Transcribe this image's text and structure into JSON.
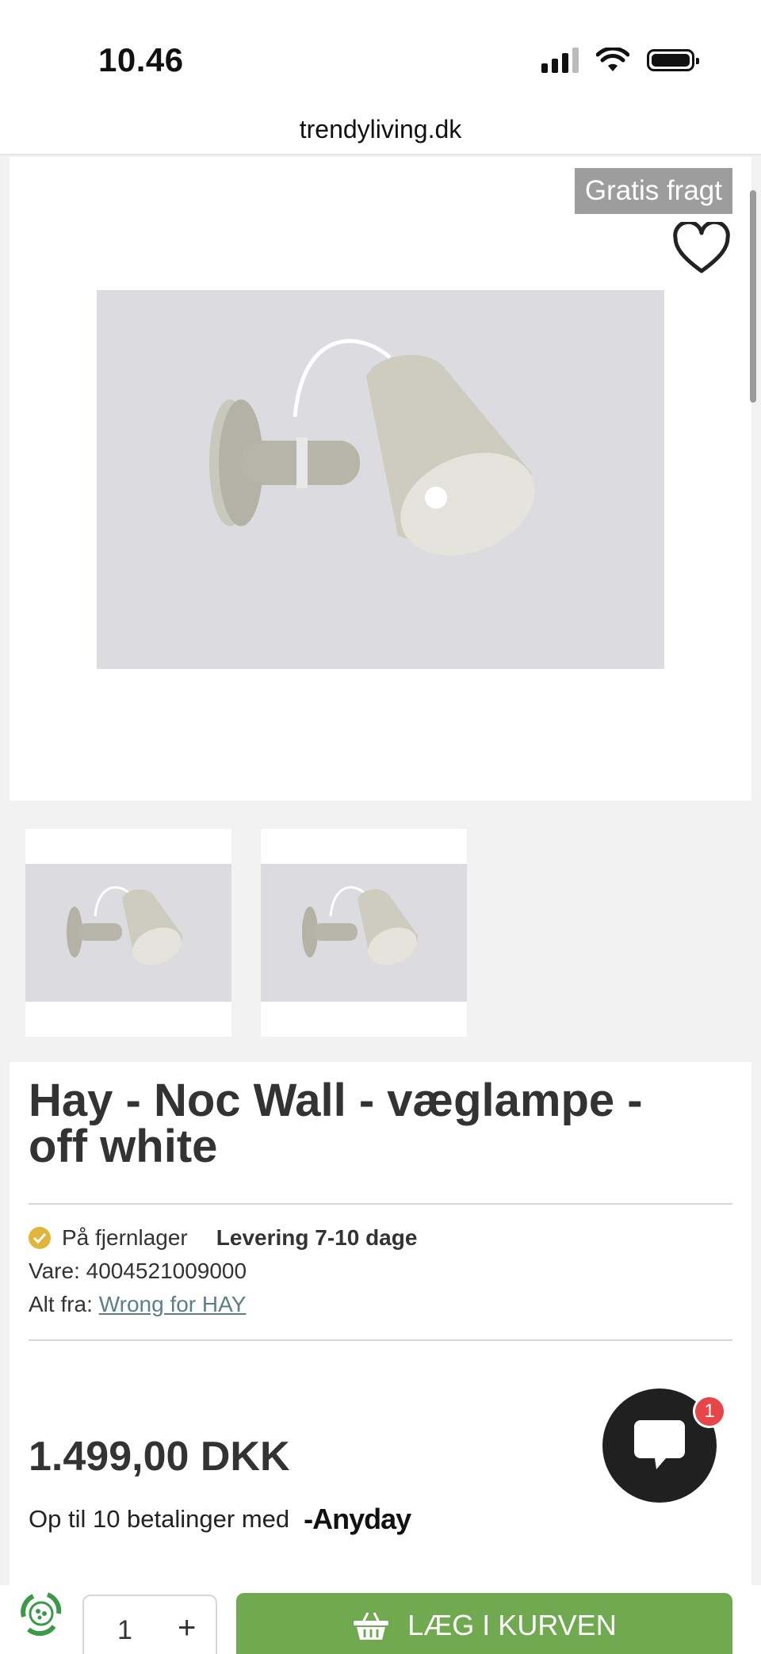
{
  "status_bar": {
    "time": "10.46"
  },
  "browser": {
    "url": "trendyliving.dk"
  },
  "product": {
    "badge": "Gratis fragt",
    "title": "Hay - Noc Wall - væglampe - off white",
    "stock_status": "På fjernlager",
    "delivery": "Levering 7-10 dage",
    "item_number_label": "Vare:",
    "item_number": "4004521009000",
    "more_from_label": "Alt fra:",
    "more_from_brand": "Wrong for HAY",
    "price": "1.499,00 DKK",
    "installments_text": "Op til 10 betalinger med",
    "installments_provider": "Anyday"
  },
  "chat": {
    "unread_count": "1"
  },
  "cart": {
    "quantity": "1",
    "plus_label": "+",
    "add_to_cart_label": "LÆG I KURVEN"
  },
  "icons": [
    "signal-icon",
    "wifi-icon",
    "battery-icon",
    "heart-icon",
    "check-icon",
    "chat-icon",
    "recycle-icon",
    "basket-icon"
  ],
  "colors": {
    "accent_green": "#70a950",
    "badge_gray": "#9d9d9d",
    "link_teal": "#5b7f86",
    "check_gold": "#e0b53a",
    "notification_red": "#e8454a"
  }
}
